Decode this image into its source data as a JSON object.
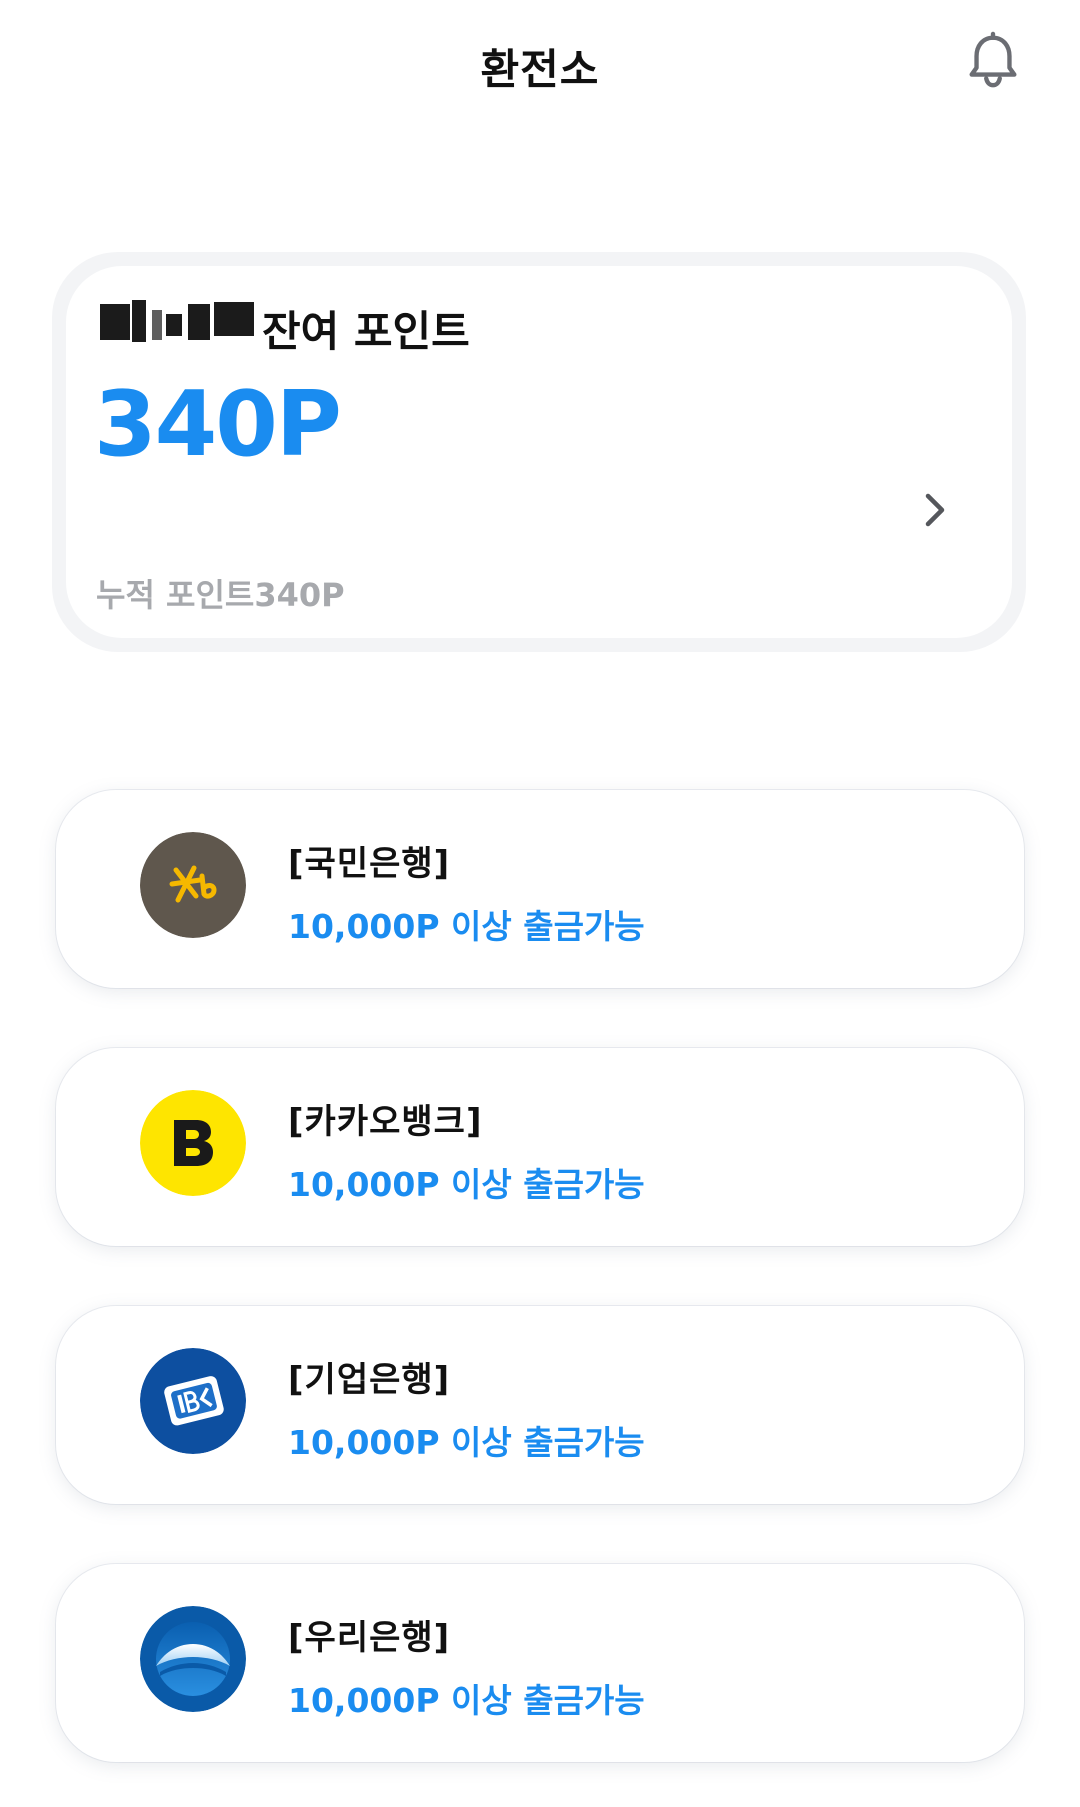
{
  "header": {
    "title": "환전소",
    "bell_icon": "bell-icon"
  },
  "points": {
    "balance_label": "잔여 포인트",
    "balance_value": "340P",
    "accum_text": "누적 포인트340P",
    "chevron_icon": "chevron-right-icon",
    "accent_color": "#1a8cf0"
  },
  "banks": [
    {
      "name": "[국민은행]",
      "limit": "10,000P 이상 출금가능",
      "logo": "kb-logo"
    },
    {
      "name": "[카카오뱅크]",
      "limit": "10,000P 이상 출금가능",
      "logo": "kakaobank-logo"
    },
    {
      "name": "[기업은행]",
      "limit": "10,000P 이상 출금가능",
      "logo": "ibk-logo"
    },
    {
      "name": "[우리은행]",
      "limit": "10,000P 이상 출금가능",
      "logo": "woori-logo"
    }
  ]
}
